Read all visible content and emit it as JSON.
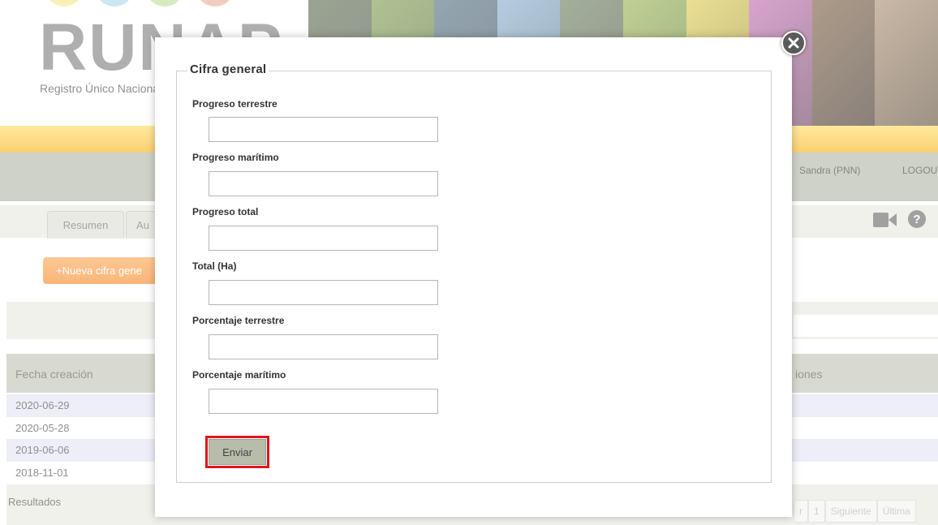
{
  "app": {
    "logo_text": "RUNAP",
    "logo_subtitle": "Registro Único Nacional de Áreas Protegidas"
  },
  "user_bar": {
    "user_name": "Sandra (PNN)",
    "logout_label": "LOGOUT"
  },
  "tabs": [
    {
      "label": "Resumen"
    },
    {
      "label": "Au"
    }
  ],
  "toolbar_icons": [
    "video-camera-icon",
    "help-icon"
  ],
  "new_button_label": "+Nueva cifra gene",
  "table": {
    "columns": [
      "Fecha creación",
      "iones"
    ],
    "rows": [
      {
        "fecha": "2020-06-29"
      },
      {
        "fecha": "2020-05-28"
      },
      {
        "fecha": "2019-06-06"
      },
      {
        "fecha": "2018-11-01"
      }
    ],
    "results_label": "Resultados",
    "pagination": [
      "r",
      "1",
      "Siguiente",
      "Última"
    ]
  },
  "modal": {
    "legend": "Cifra general",
    "fields": [
      {
        "label": "Progreso terrestre",
        "value": ""
      },
      {
        "label": "Progreso marítimo",
        "value": ""
      },
      {
        "label": "Progreso total",
        "value": ""
      },
      {
        "label": "Total (Ha)",
        "value": ""
      },
      {
        "label": "Porcentaje terrestre",
        "value": ""
      },
      {
        "label": "Porcentaje marítimo",
        "value": ""
      }
    ],
    "submit_label": "Enviar",
    "close_icon": "close-icon"
  },
  "colors": {
    "orange_button": "#f27b0c",
    "header_band": "#a7ad9d",
    "highlight_frame": "#e1141d",
    "submit_button": "#b7bcab"
  }
}
